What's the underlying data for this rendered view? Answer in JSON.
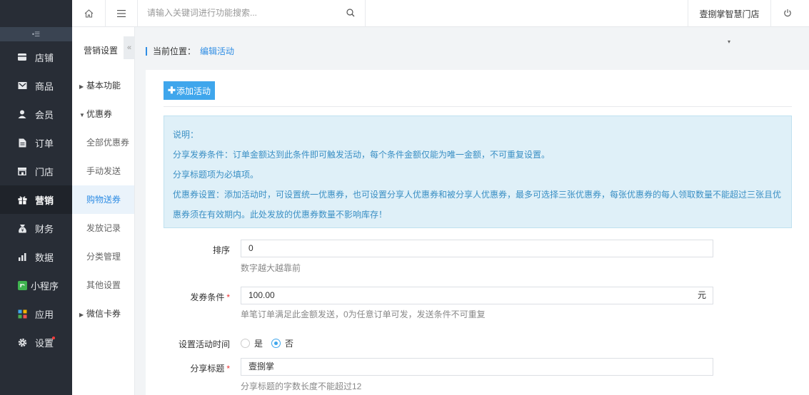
{
  "sidebar": {
    "items": [
      {
        "label": "店铺",
        "icon": "store-icon"
      },
      {
        "label": "商品",
        "icon": "goods-icon"
      },
      {
        "label": "会员",
        "icon": "member-icon"
      },
      {
        "label": "订单",
        "icon": "order-icon"
      },
      {
        "label": "门店",
        "icon": "shop-icon"
      },
      {
        "label": "营销",
        "icon": "gift-icon"
      },
      {
        "label": "财务",
        "icon": "finance-icon"
      },
      {
        "label": "数据",
        "icon": "chart-icon"
      },
      {
        "label": "小程序",
        "icon": "miniapp-icon"
      },
      {
        "label": "应用",
        "icon": "apps-icon"
      },
      {
        "label": "设置",
        "icon": "gear-icon"
      }
    ],
    "active": "营销"
  },
  "subnav": {
    "title": "营销设置",
    "fold": "«",
    "items": [
      {
        "label": "基本功能",
        "type": "group",
        "expanded": false
      },
      {
        "label": "优惠券",
        "type": "group",
        "expanded": true
      },
      {
        "label": "全部优惠券",
        "type": "child"
      },
      {
        "label": "手动发送",
        "type": "child"
      },
      {
        "label": "购物送券",
        "type": "child",
        "active": true
      },
      {
        "label": "发放记录",
        "type": "child"
      },
      {
        "label": "分类管理",
        "type": "child"
      },
      {
        "label": "其他设置",
        "type": "child"
      },
      {
        "label": "微信卡券",
        "type": "group",
        "expanded": false
      }
    ]
  },
  "topbar": {
    "search_placeholder": "请输入关键词进行功能搜索...",
    "store_name": "壹捌掌智慧门店"
  },
  "breadcrumb": {
    "label": "当前位置：",
    "current": "编辑活动"
  },
  "main": {
    "add_button": "添加活动",
    "note_lines": [
      "说明：",
      "分享发券条件：订单金额达到此条件即可触发活动，每个条件金额仅能为唯一金额，不可重复设置。",
      "分享标题项为必填项。",
      "优惠券设置：添加活动时，可设置统一优惠券，也可设置分享人优惠券和被分享人优惠券，最多可选择三张优惠券，每张优惠券的每人领取数量不能超过三张且优",
      "惠券须在有效期内。此处发放的优惠券数量不影响库存！"
    ],
    "form": {
      "sort": {
        "label": "排序",
        "value": "0",
        "help": "数字越大越靠前"
      },
      "condition": {
        "label": "发券条件",
        "required": "*",
        "value": "100.00",
        "suffix": "元",
        "help": "单笔订单满足此金额发送，0为任意订单可发，发送条件不可重复"
      },
      "time": {
        "label": "设置活动时间",
        "options": [
          "是",
          "否"
        ],
        "selected": "否"
      },
      "share_title": {
        "label": "分享标题",
        "required": "*",
        "value": "壹捌掌",
        "help": "分享标题的字数长度不能超过12"
      }
    }
  },
  "colors": {
    "sidebar_bg": "#282d36",
    "accent": "#2f8de4",
    "button": "#3fa6ec",
    "note_bg": "#dff0f8"
  }
}
